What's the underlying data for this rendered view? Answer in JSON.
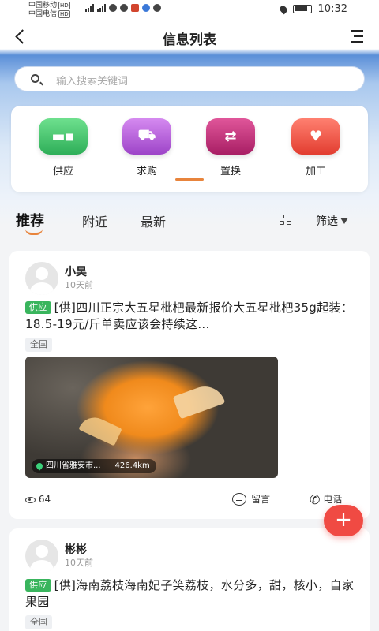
{
  "status_bar": {
    "carrier1": "中国移动",
    "carrier2": "中国电信",
    "carrier_tag": "HD",
    "time": "10:32"
  },
  "nav": {
    "title": "信息列表"
  },
  "search": {
    "placeholder": "输入搜索关键词"
  },
  "categories": [
    {
      "label": "供应",
      "icon": "truck-icon",
      "color": "#3cc26a"
    },
    {
      "label": "求购",
      "icon": "cart-icon",
      "color": "#b25ed6"
    },
    {
      "label": "置换",
      "icon": "exchange-icon",
      "color": "#c2307a"
    },
    {
      "label": "加工",
      "icon": "heart-plus-icon",
      "color": "#ef5646"
    }
  ],
  "tabs": [
    "推荐",
    "附近",
    "最新"
  ],
  "filter_label": "筛选",
  "accent_color": "#e8843c",
  "posts": [
    {
      "author": "小昊",
      "time": "10天前",
      "badge": "供应",
      "text": "[供]四川正宗大五星枇杷最新报价大五星枇杷35g起装：18.5-19元/斤单卖应该会持续这...",
      "region": "全国",
      "location": "四川省雅安市...",
      "distance": "426.4km",
      "views": "64",
      "message_label": "留言",
      "call_label": "电话"
    },
    {
      "author": "彬彬",
      "time": "10天前",
      "badge": "供应",
      "text": "[供]海南荔枝海南妃子笑荔枝，水分多，甜，核小，自家果园",
      "region": "全国"
    }
  ],
  "fab_label": "+"
}
